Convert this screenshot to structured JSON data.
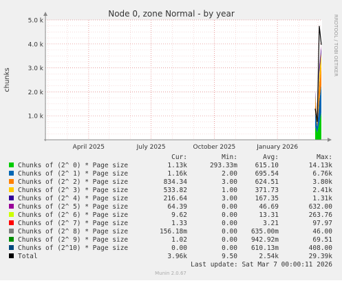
{
  "chart_data": {
    "type": "area",
    "title": "Node 0, zone Normal - by year",
    "ylabel": "chunks",
    "watermark": "RRDTOOL / TOBI OETIKER",
    "footer": "Munin 2.0.67",
    "last_update": "Last update: Sat Mar  7 00:00:11 2026",
    "ylim": [
      0,
      5000
    ],
    "y_ticks": [
      {
        "value": 1000,
        "label": "1.0 k"
      },
      {
        "value": 2000,
        "label": "2.0 k"
      },
      {
        "value": 3000,
        "label": "3.0 k"
      },
      {
        "value": 4000,
        "label": "4.0 k"
      },
      {
        "value": 5000,
        "label": "5.0 k"
      }
    ],
    "x_range": [
      "2025-01-28",
      "2026-03-07"
    ],
    "x_ticks": [
      {
        "date": "2025-04-01",
        "label": "April 2025"
      },
      {
        "date": "2025-07-01",
        "label": "July 2025"
      },
      {
        "date": "2025-10-01",
        "label": "October 2025"
      },
      {
        "date": "2026-01-01",
        "label": "January 2026"
      }
    ],
    "x_month_grid": [
      "2025-02-01",
      "2025-03-01",
      "2025-04-01",
      "2025-05-01",
      "2025-06-01",
      "2025-07-01",
      "2025-08-01",
      "2025-09-01",
      "2025-10-01",
      "2025-11-01",
      "2025-12-01",
      "2026-01-01",
      "2026-02-01",
      "2026-03-01"
    ],
    "data_start": "2026-02-25",
    "legend_headers": [
      "Cur:",
      "Min:",
      "Avg:",
      "Max:"
    ],
    "series": [
      {
        "name": "Chunks of (2^ 0) * Page size",
        "color": "#00cc00",
        "cur": "1.13k",
        "min": "293.33m",
        "avg": "615.10",
        "max": "14.13k",
        "values": [
          550,
          300,
          700,
          1130
        ]
      },
      {
        "name": "Chunks of (2^ 1) * Page size",
        "color": "#0066b3",
        "cur": "1.16k",
        "min": "2.00",
        "avg": "695.54",
        "max": "6.76k",
        "values": [
          600,
          250,
          900,
          1160
        ]
      },
      {
        "name": "Chunks of (2^ 2) * Page size",
        "color": "#ff8000",
        "cur": "834.34",
        "min": "3.00",
        "avg": "624.51",
        "max": "3.80k",
        "values": [
          550,
          120,
          650,
          834
        ]
      },
      {
        "name": "Chunks of (2^ 3) * Page size",
        "color": "#ffcc00",
        "cur": "533.82",
        "min": "1.00",
        "avg": "371.73",
        "max": "2.41k",
        "values": [
          180,
          60,
          500,
          534
        ]
      },
      {
        "name": "Chunks of (2^ 4) * Page size",
        "color": "#330099",
        "cur": "216.64",
        "min": "3.00",
        "avg": "167.35",
        "max": "1.31k",
        "values": [
          120,
          40,
          260,
          217
        ]
      },
      {
        "name": "Chunks of (2^ 5) * Page size",
        "color": "#990099",
        "cur": "64.39",
        "min": "0.00",
        "avg": "46.69",
        "max": "632.00",
        "values": [
          30,
          10,
          80,
          64
        ]
      },
      {
        "name": "Chunks of (2^ 6) * Page size",
        "color": "#ccff00",
        "cur": "9.62",
        "min": "0.00",
        "avg": "13.31",
        "max": "263.76",
        "values": [
          10,
          5,
          20,
          10
        ]
      },
      {
        "name": "Chunks of (2^ 7) * Page size",
        "color": "#ff0000",
        "cur": "1.33",
        "min": "0.00",
        "avg": "3.21",
        "max": "97.97",
        "values": [
          3,
          1,
          4,
          1
        ]
      },
      {
        "name": "Chunks of (2^ 8) * Page size",
        "color": "#808080",
        "cur": "156.18m",
        "min": "0.00",
        "avg": "635.00m",
        "max": "46.00",
        "values": [
          1,
          0,
          1,
          0
        ]
      },
      {
        "name": "Chunks of (2^ 9) * Page size",
        "color": "#008f00",
        "cur": "1.02",
        "min": "0.00",
        "avg": "942.92m",
        "max": "69.51",
        "values": [
          1,
          0,
          1,
          1
        ]
      },
      {
        "name": "Chunks of (2^10) * Page size",
        "color": "#00487d",
        "cur": "0.00",
        "min": "0.00",
        "avg": "610.13m",
        "max": "408.00",
        "values": [
          1,
          0,
          1,
          0
        ]
      },
      {
        "name": "Total",
        "color": "#000000",
        "cur": "3.96k",
        "min": "9.50",
        "avg": "2.54k",
        "max": "29.39k",
        "values": [
          1300,
          750,
          4750,
          3960
        ]
      }
    ]
  }
}
